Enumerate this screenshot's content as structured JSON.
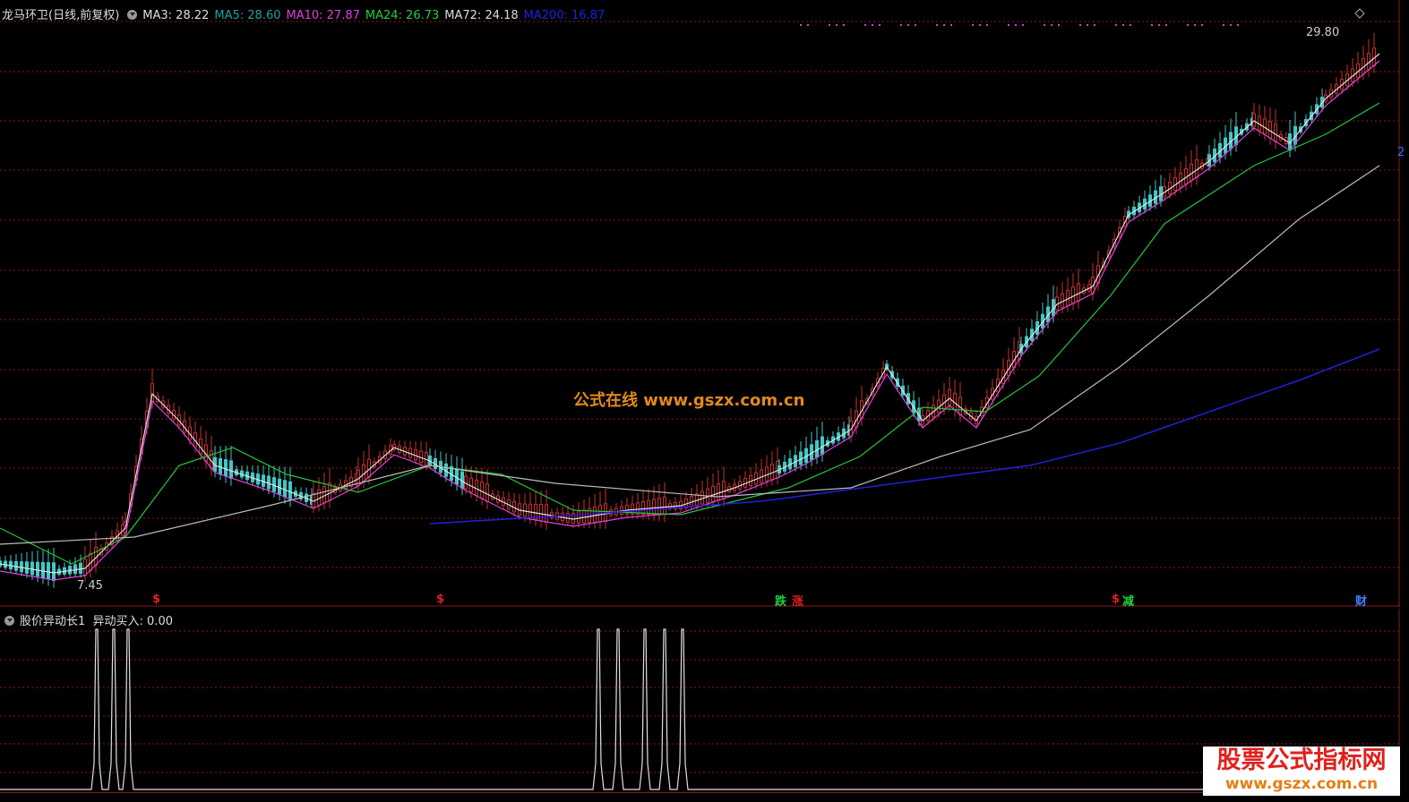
{
  "header": {
    "stock_name": "龙马环卫(日线,前复权)",
    "ma": [
      {
        "label": "MA3: 28.22",
        "color": "#dddddd"
      },
      {
        "label": "MA5: 28.60",
        "color": "#1fa0a0"
      },
      {
        "label": "MA10: 27.87",
        "color": "#e040e0"
      },
      {
        "label": "MA24: 26.73",
        "color": "#20d040"
      },
      {
        "label": "MA72: 24.18",
        "color": "#dddddd"
      },
      {
        "label": "MA200: 16.87",
        "color": "#2020e0"
      }
    ]
  },
  "price_labels": {
    "high": "29.80",
    "low": "7.45",
    "right_edge": "2"
  },
  "markers": [
    {
      "text": "$",
      "color": "#e02020"
    },
    {
      "text": "$",
      "color": "#e02020"
    },
    {
      "text": "跌",
      "color": "#20d040"
    },
    {
      "text": "涨",
      "color": "#e02020"
    },
    {
      "text": "$",
      "color": "#e02020"
    },
    {
      "text": "减",
      "color": "#20d040"
    },
    {
      "text": "财",
      "color": "#4080ff"
    }
  ],
  "watermark": "公式在线  www.gszx.com.cn",
  "sub_panel": {
    "indicator": "股价异动长1",
    "value_label": "异动买入: 0.00"
  },
  "brand": {
    "line1": "股票公式指标网",
    "line2": "www.gszx.com.cn"
  }
}
